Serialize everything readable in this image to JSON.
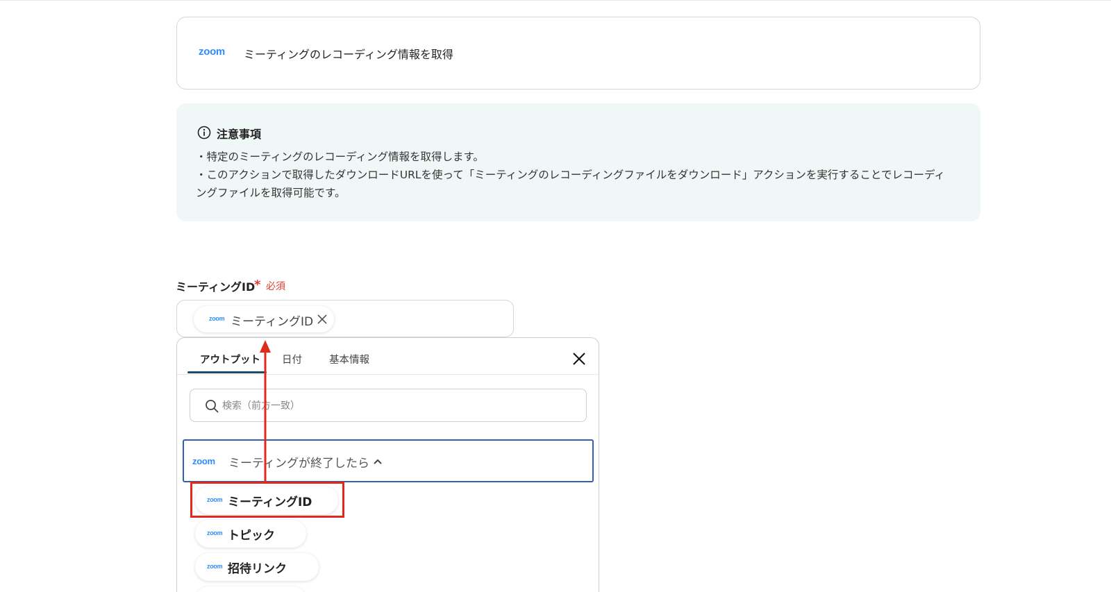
{
  "action_card": {
    "app_logo": "zoom",
    "title": "ミーティングのレコーディング情報を取得"
  },
  "notice": {
    "icon": "info-circle-icon",
    "title": "注意事項",
    "lines": [
      "・特定のミーティングのレコーディング情報を取得します。",
      "・このアクションで取得したダウンロードURLを使って「ミーティングのレコーディングファイルをダウンロード」アクションを実行することでレコーディ",
      "ングファイルを取得可能です。"
    ]
  },
  "field": {
    "label": "ミーティングID",
    "required_mark": "*",
    "required_text": "必須",
    "chip": {
      "logo": "zoom",
      "label": "ミーティングID"
    }
  },
  "panel": {
    "tabs": [
      {
        "label": "アウトプット",
        "active": true
      },
      {
        "label": "日付",
        "active": false
      },
      {
        "label": "基本情報",
        "active": false
      }
    ],
    "search_placeholder": "検索（前方一致）",
    "group": {
      "logo": "zoom",
      "label": "ミーティングが終了したら",
      "expanded": true
    },
    "items": [
      {
        "logo": "zoom",
        "label": "ミーティングID",
        "highlighted": true
      },
      {
        "logo": "zoom",
        "label": "トピック"
      },
      {
        "logo": "zoom",
        "label": "招待リンク"
      },
      {
        "logo": "zoom",
        "label": ""
      }
    ]
  },
  "colors": {
    "zoom_blue": "#2d8cff",
    "required_red": "#e03c2e",
    "highlight_red": "#e02b1c",
    "notice_bg": "#eff8f7",
    "group_border": "#2e5fb3"
  }
}
